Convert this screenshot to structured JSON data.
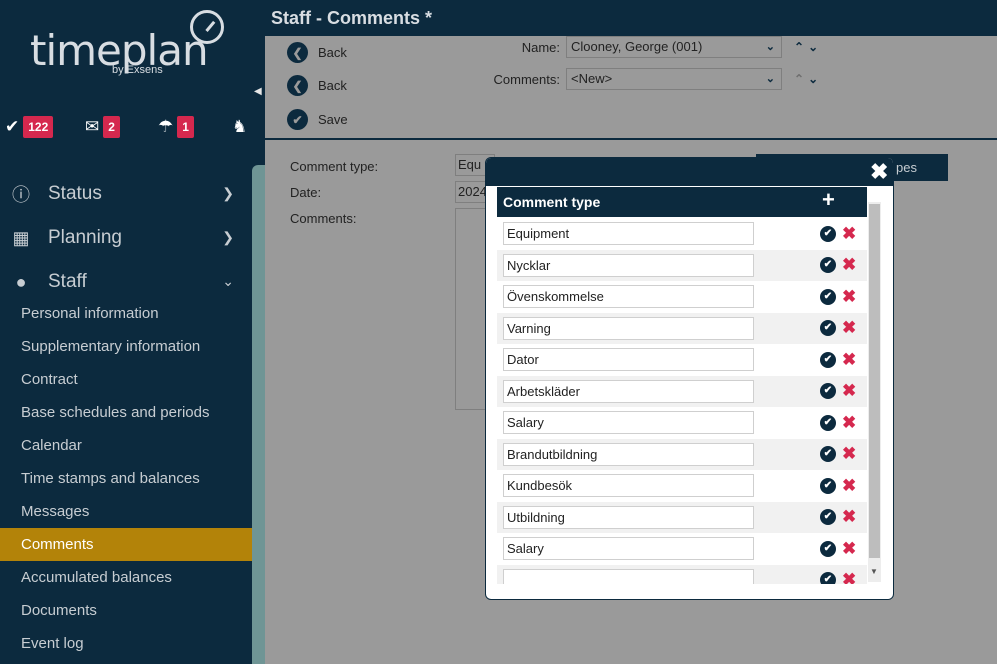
{
  "app": {
    "logo_text": "timeplan",
    "logo_by": "by Exsens"
  },
  "header": {
    "title": "Staff - Comments *"
  },
  "badges": [
    {
      "icon": "check-icon",
      "count": "122"
    },
    {
      "icon": "mail-icon",
      "count": "2"
    },
    {
      "icon": "umbrella-icon",
      "count": "1"
    },
    {
      "icon": "owl-icon",
      "count": ""
    }
  ],
  "nav": {
    "main": [
      {
        "label": "Status",
        "icon": "info-icon"
      },
      {
        "label": "Planning",
        "icon": "calendar-icon"
      },
      {
        "label": "Staff",
        "icon": "person-icon"
      }
    ],
    "sub": [
      "Personal information",
      "Supplementary information",
      "Contract",
      "Base schedules and periods",
      "Calendar",
      "Time stamps and balances",
      "Messages",
      "Comments",
      "Accumulated balances",
      "Documents",
      "Event log"
    ],
    "active_sub": "Comments"
  },
  "toolbar": {
    "back1": "Back",
    "back2": "Back",
    "save": "Save"
  },
  "fields": {
    "name_label": "Name:",
    "name_value": "Clooney, George (001)",
    "comments_label": "Comments:",
    "comments_value": "<New>"
  },
  "form": {
    "comment_type_label": "Comment type:",
    "comment_type_value": "Equ",
    "date_label": "Date:",
    "date_value": "2024",
    "comments_label": "Comments:",
    "bg_button_text": "pes"
  },
  "modal": {
    "header_title": "Comment type",
    "add_icon": "plus-icon",
    "close_icon": "close-icon",
    "items": [
      "Equipment",
      "Nycklar",
      "Övenskommelse",
      "Varning",
      "Dator",
      "Arbetskläder",
      "Salary",
      "Brandutbildning",
      "Kundbesök",
      "Utbildning",
      "Salary",
      ""
    ]
  },
  "colors": {
    "navy": "#0c2a3e",
    "active": "#b38309",
    "badge": "#d5284e"
  }
}
